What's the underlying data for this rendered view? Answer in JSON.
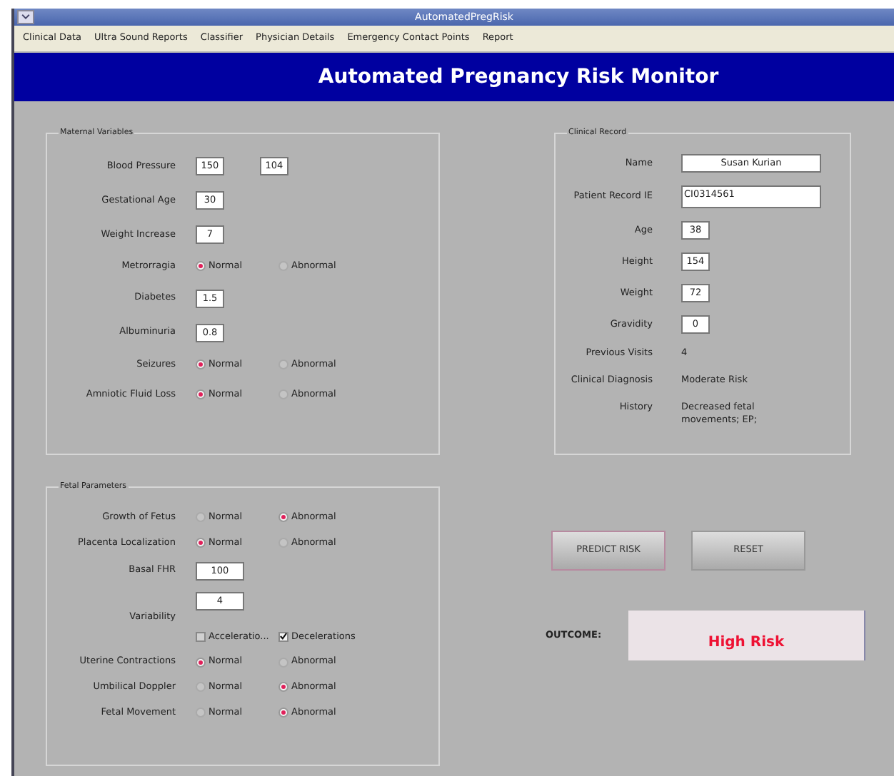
{
  "window": {
    "title": "AutomatedPregRisk"
  },
  "menu": [
    "Clinical Data",
    "Ultra Sound Reports",
    "Classifier",
    "Physician Details",
    "Emergency Contact Points",
    "Report"
  ],
  "header": "Automated Pregnancy Risk Monitor",
  "maternal_variables": {
    "title": "Maternal Variables",
    "rows": [
      {
        "kind": "fields",
        "label": "Blood Pressure",
        "values": [
          "150",
          "104"
        ]
      },
      {
        "kind": "fields",
        "label": "Gestational Age",
        "values": [
          "30"
        ]
      },
      {
        "kind": "fields",
        "label": "Weight Increase",
        "values": [
          "7"
        ]
      },
      {
        "kind": "radio",
        "label": "Metrorragia",
        "options": [
          {
            "label": "Normal",
            "selected": true
          },
          {
            "label": "Abnormal",
            "selected": false
          }
        ]
      },
      {
        "kind": "fields",
        "label": "Diabetes",
        "values": [
          "1.5"
        ]
      },
      {
        "kind": "fields",
        "label": "Albuminuria",
        "values": [
          "0.8"
        ]
      },
      {
        "kind": "radio",
        "label": "Seizures",
        "options": [
          {
            "label": "Normal",
            "selected": true
          },
          {
            "label": "Abnormal",
            "selected": false
          }
        ]
      },
      {
        "kind": "radio",
        "label": "Amniotic Fluid Loss",
        "options": [
          {
            "label": "Normal",
            "selected": true
          },
          {
            "label": "Abnormal",
            "selected": false
          }
        ]
      }
    ]
  },
  "fetal_parameters": {
    "title": "Fetal Parameters",
    "rows": [
      {
        "kind": "radio",
        "label": "Growth of Fetus",
        "options": [
          {
            "label": "Normal",
            "selected": false
          },
          {
            "label": "Abnormal",
            "selected": true
          }
        ]
      },
      {
        "kind": "radio",
        "label": "Placenta Localization",
        "options": [
          {
            "label": "Normal",
            "selected": true
          },
          {
            "label": "Abnormal",
            "selected": false
          }
        ]
      },
      {
        "kind": "fields",
        "label": "Basal FHR",
        "values": [
          "100"
        ]
      },
      {
        "kind": "field_checks",
        "label": "Variability",
        "value": "4",
        "checks": [
          {
            "label": "Acceleratio...",
            "checked": false
          },
          {
            "label": "Decelerations",
            "checked": true
          }
        ]
      },
      {
        "kind": "radio",
        "label": "Uterine Contractions",
        "options": [
          {
            "label": "Normal",
            "selected": true
          },
          {
            "label": "Abnormal",
            "selected": false
          }
        ]
      },
      {
        "kind": "radio",
        "label": "Umbilical Doppler",
        "options": [
          {
            "label": "Normal",
            "selected": false
          },
          {
            "label": "Abnormal",
            "selected": true
          }
        ]
      },
      {
        "kind": "radio",
        "label": "Fetal Movement",
        "options": [
          {
            "label": "Normal",
            "selected": false
          },
          {
            "label": "Abnormal",
            "selected": true
          }
        ]
      }
    ]
  },
  "clinical_record": {
    "title": "Clinical Record",
    "rows": [
      {
        "kind": "wide_field",
        "label": "Name",
        "value": "Susan Kurian"
      },
      {
        "kind": "tall_field",
        "label": "Patient Record IE",
        "value": "CI0314561"
      },
      {
        "kind": "field",
        "label": "Age",
        "value": "38"
      },
      {
        "kind": "field",
        "label": "Height",
        "value": "154"
      },
      {
        "kind": "field",
        "label": "Weight",
        "value": "72"
      },
      {
        "kind": "field",
        "label": "Gravidity",
        "value": "0"
      },
      {
        "kind": "text",
        "label": "Previous Visits",
        "value": "4"
      },
      {
        "kind": "text",
        "label": "Clinical Diagnosis",
        "value": "Moderate Risk"
      },
      {
        "kind": "text",
        "label": "History",
        "value": "Decreased fetal movements; EP;"
      }
    ]
  },
  "buttons": [
    {
      "label": "PREDICT RISK",
      "focused": true
    },
    {
      "label": "RESET",
      "focused": false
    }
  ],
  "outcome": {
    "label": "OUTCOME:",
    "value": "High Risk"
  }
}
